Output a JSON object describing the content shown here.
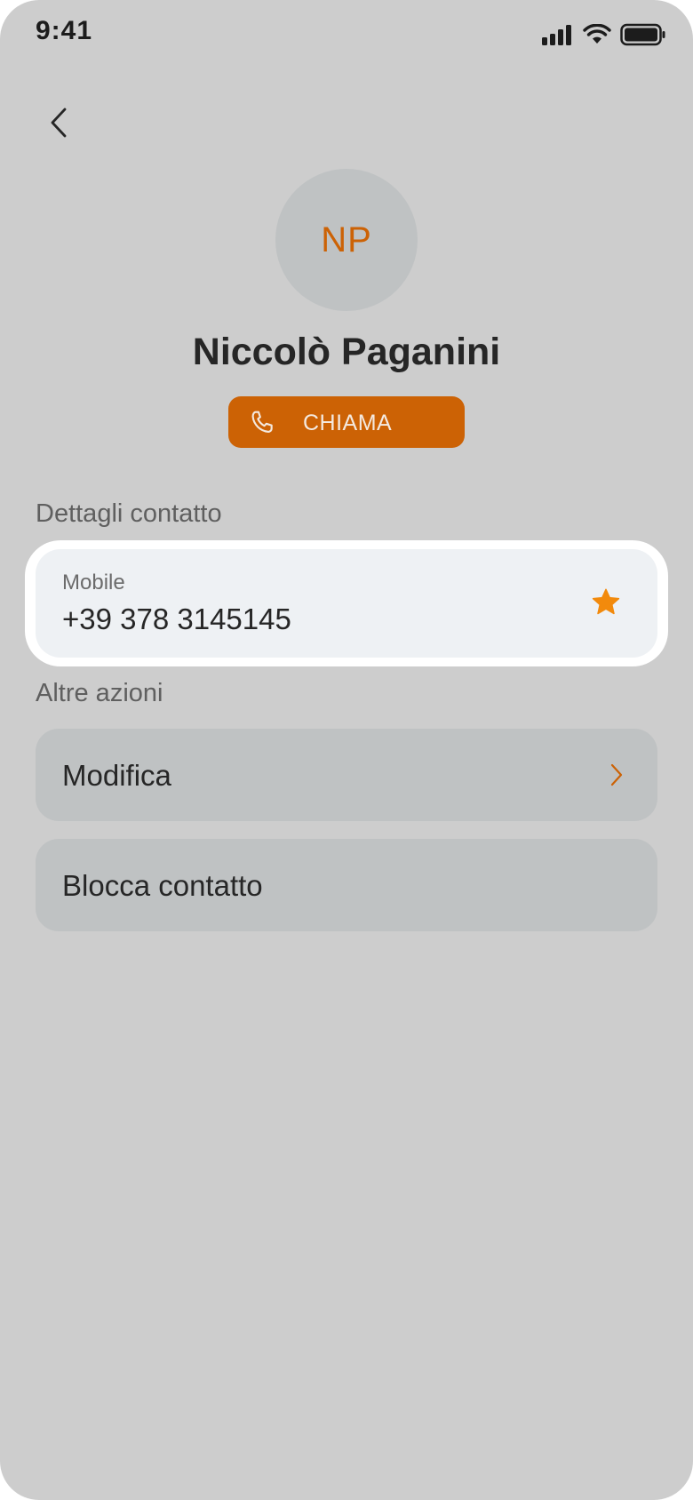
{
  "status_bar": {
    "time": "9:41"
  },
  "icons": {
    "back": "chevron-left-icon",
    "call": "phone-icon",
    "favorite": "star-icon",
    "row_chevron": "chevron-right-icon",
    "signal": "cellular-signal-icon",
    "wifi": "wifi-icon",
    "battery": "battery-icon"
  },
  "contact": {
    "initials": "NP",
    "name": "Niccolò Paganini"
  },
  "call_button": {
    "label": "CHIAMA"
  },
  "details_section": {
    "title": "Dettagli contatto",
    "phone_type": "Mobile",
    "phone_number": "+39 378 3145145"
  },
  "actions_section": {
    "title": "Altre azioni",
    "items": [
      {
        "label": "Modifica"
      },
      {
        "label": "Blocca contatto"
      }
    ]
  },
  "colors": {
    "accent": "#cc6205",
    "star": "#f28a0c",
    "background": "#cdcdcd",
    "card": "#eef1f4",
    "row": "#bfc2c3"
  }
}
